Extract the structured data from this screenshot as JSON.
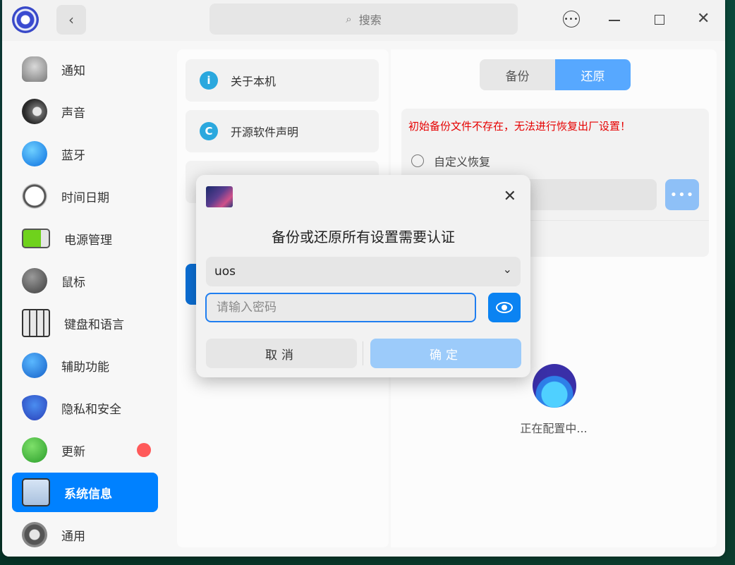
{
  "titlebar": {
    "back_glyph": "‹",
    "search_icon": "⌕",
    "search_placeholder": "搜索",
    "menu_glyph": "•••",
    "close_glyph": "✕"
  },
  "sidebar": {
    "items": [
      {
        "label": "通知",
        "icon": "bell-icon"
      },
      {
        "label": "声音",
        "icon": "speaker-icon"
      },
      {
        "label": "蓝牙",
        "icon": "bluetooth-icon"
      },
      {
        "label": "时间日期",
        "icon": "clock-icon"
      },
      {
        "label": "电源管理",
        "icon": "battery-icon"
      },
      {
        "label": "鼠标",
        "icon": "mouse-icon"
      },
      {
        "label": "键盘和语言",
        "icon": "keyboard-icon"
      },
      {
        "label": "辅助功能",
        "icon": "accessibility-icon"
      },
      {
        "label": "隐私和安全",
        "icon": "shield-icon"
      },
      {
        "label": "更新",
        "icon": "update-icon"
      },
      {
        "label": "系统信息",
        "icon": "system-info-icon"
      },
      {
        "label": "通用",
        "icon": "gear-icon"
      }
    ],
    "active_index": 10
  },
  "middle": {
    "items": [
      {
        "label": "关于本机",
        "glyph": "i"
      },
      {
        "label": "开源软件声明",
        "glyph": "C"
      }
    ]
  },
  "right": {
    "tabs": [
      {
        "label": "备份",
        "selected": false
      },
      {
        "label": "还原",
        "selected": true
      }
    ],
    "warning": "初始备份文件不存在，无法进行恢复出厂设置！",
    "radio_label": "自定义恢复",
    "more_glyph": "•••",
    "status": "正在配置中..."
  },
  "dialog": {
    "title": "备份或还原所有设置需要认证",
    "user_value": "uos",
    "chevron": "⌄",
    "password_placeholder": "请输入密码",
    "cancel_label": "取消",
    "ok_label": "确定",
    "close_glyph": "✕"
  },
  "colors": {
    "accent": "#0081ff",
    "warning": "#e60000",
    "update_badge": "#ff5a5a"
  }
}
